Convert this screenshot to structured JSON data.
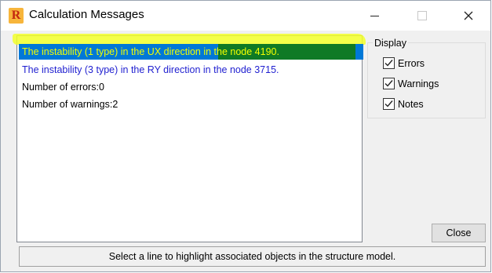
{
  "window": {
    "title": "Calculation Messages",
    "app_icon_letter": "R"
  },
  "messages": [
    {
      "text": "The instability (1 type) in the UX direction in the node 4190.",
      "selected": true
    },
    {
      "text": "The instability (3 type) in the RY direction in the node 3715.",
      "selected": false
    },
    {
      "text": "Number of errors:0",
      "selected": false
    },
    {
      "text": "Number of warnings:2",
      "selected": false
    }
  ],
  "display": {
    "label": "Display",
    "options": [
      {
        "label": "Errors",
        "checked": true
      },
      {
        "label": "Warnings",
        "checked": true
      },
      {
        "label": "Notes",
        "checked": true
      }
    ]
  },
  "buttons": {
    "close_label": "Close"
  },
  "status": {
    "text": "Select a line to highlight associated objects in the structure model."
  },
  "colors": {
    "selection_bg": "#0078d7",
    "selected_text": "#f3ff00",
    "warning_text": "#1f1fd0",
    "highlighter_yellow": "#f2ff2a",
    "highlighter_green": "#0f7a25"
  },
  "icons": {
    "minimize": "minimize-icon",
    "maximize": "maximize-icon",
    "close": "close-icon",
    "checkbox": "checkmark-icon"
  }
}
